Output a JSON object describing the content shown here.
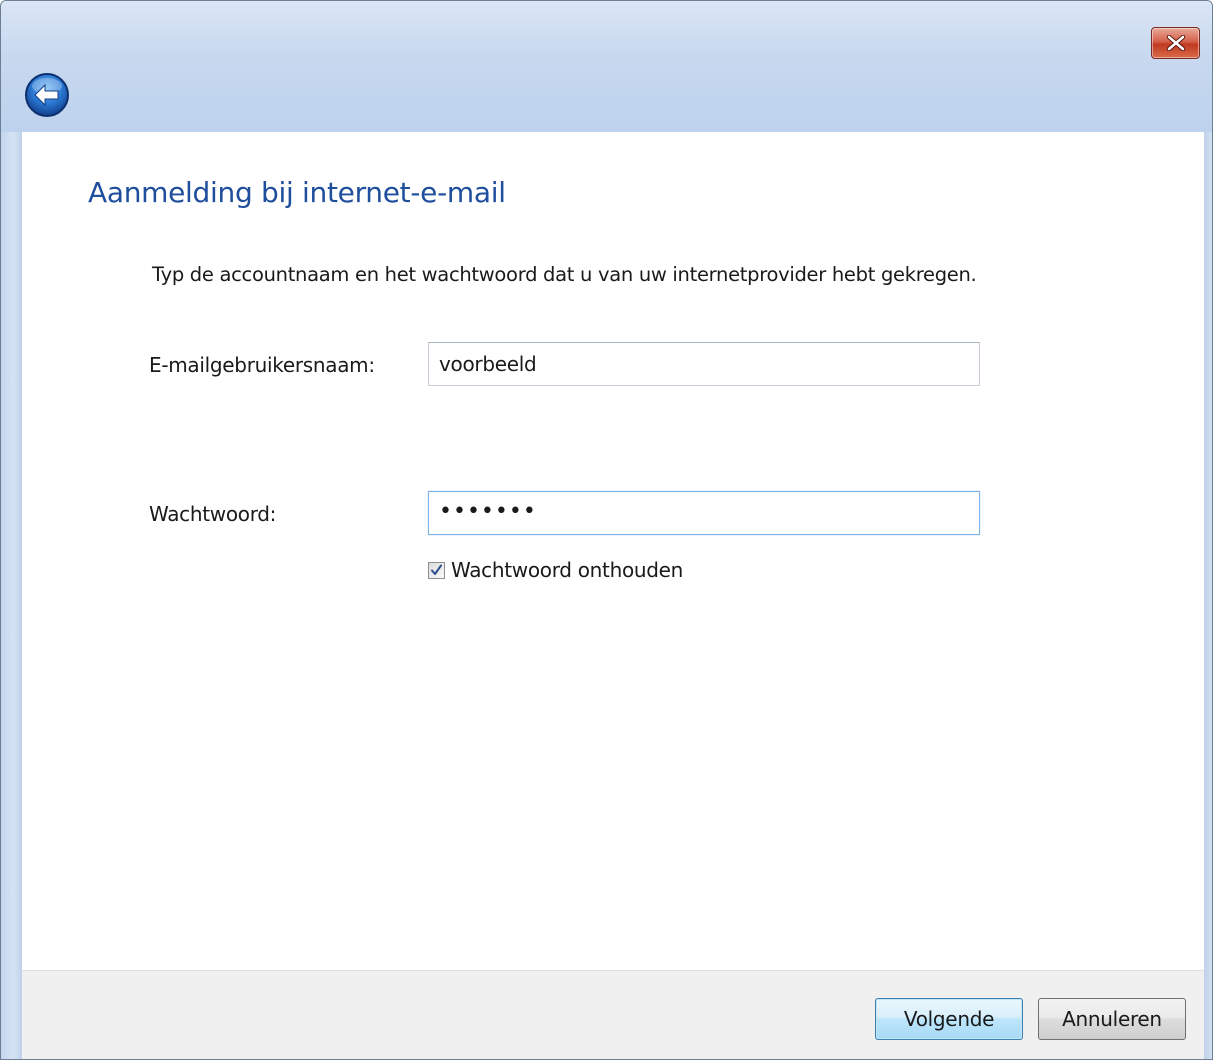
{
  "titlebar": {
    "back_icon": "back-arrow-icon",
    "close_icon": "close-x-icon"
  },
  "page": {
    "heading": "Aanmelding bij internet-e-mail",
    "instruction": "Typ de accountnaam en het wachtwoord dat u van uw internetprovider hebt gekregen."
  },
  "form": {
    "username_label": "E-mailgebruikersnaam:",
    "username_value": "voorbeeld",
    "password_label": "Wachtwoord:",
    "password_value": "•••••••",
    "remember_label": "Wachtwoord onthouden",
    "remember_checked": true
  },
  "footer": {
    "next_label": "Volgende",
    "cancel_label": "Annuleren"
  },
  "colors": {
    "heading": "#1e4e9c",
    "titlebar": "#c8d9ef",
    "close_button": "#c0391f"
  }
}
